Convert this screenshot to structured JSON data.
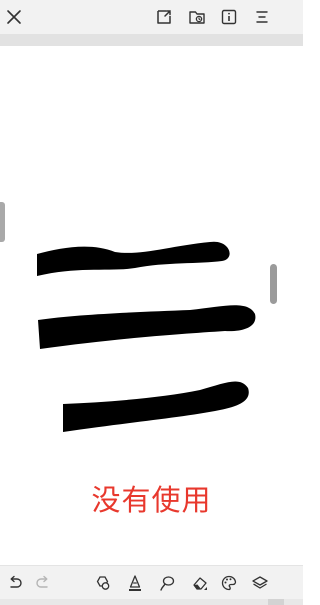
{
  "toolbar_top": {
    "close_icon": "close-icon",
    "export_icon": "export-icon",
    "folder_icon": "folder-icon",
    "info_icon": "info-icon",
    "menu_icon": "menu-icon"
  },
  "canvas": {
    "caption": "没有使用",
    "caption_color": "#e8382d",
    "stroke_color": "#000000",
    "strokes_count": 3
  },
  "toolbar_bottom": {
    "undo_icon": "undo-icon",
    "redo_icon": "redo-icon",
    "shapes_icon": "shapes-icon",
    "pen_icon": "pen-icon",
    "lasso_icon": "lasso-icon",
    "eraser_icon": "eraser-icon",
    "palette_icon": "palette-icon",
    "layers_icon": "layers-icon"
  },
  "colors": {
    "toolbar_bg": "#f2f2f2",
    "divider": "#e2e2e2",
    "icon": "#333333"
  }
}
